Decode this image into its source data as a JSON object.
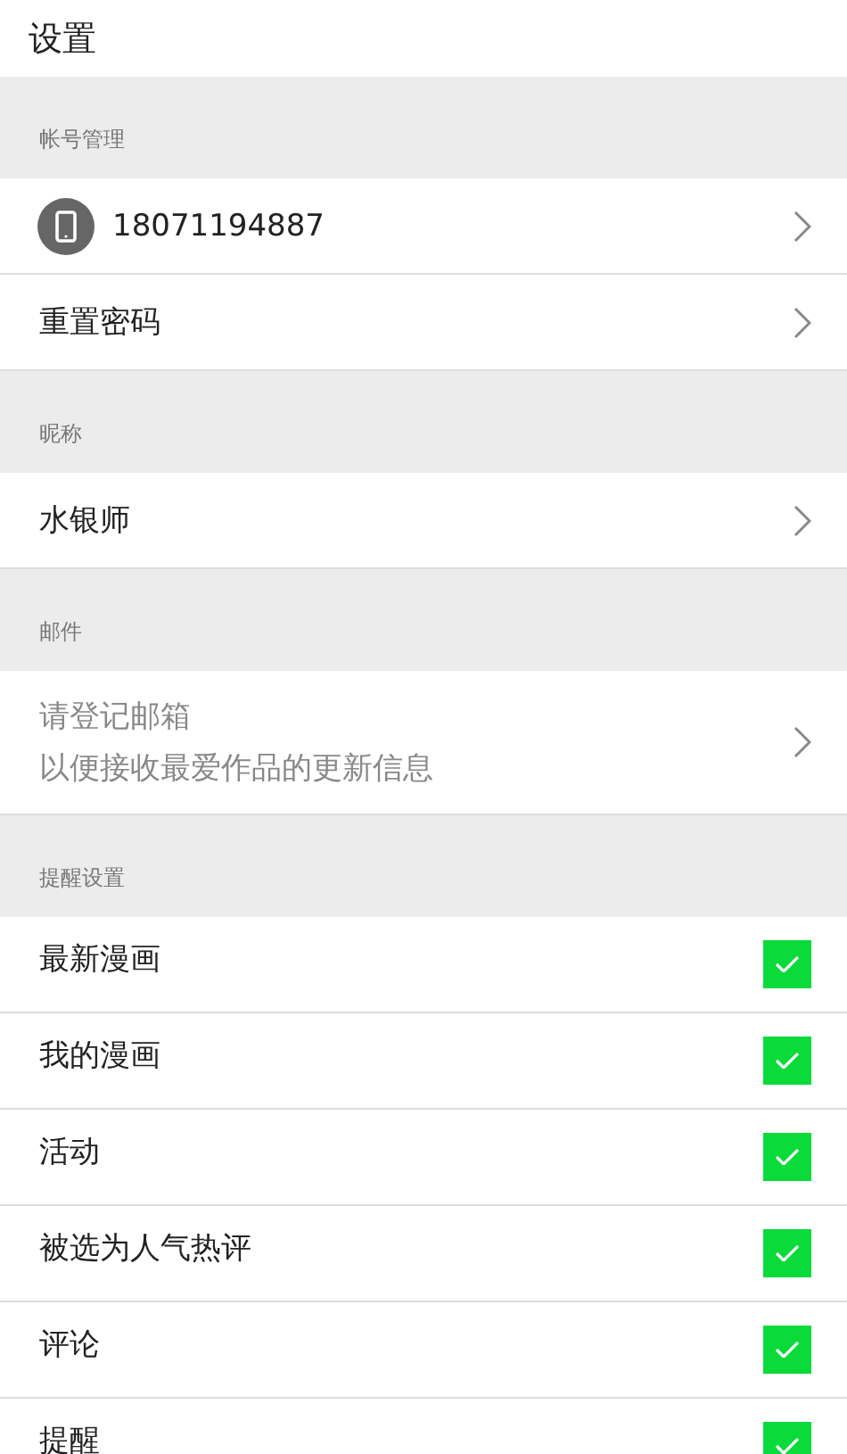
{
  "title": "设置",
  "sections": [
    {
      "header": "帐号管理",
      "rows": [
        {
          "kind": "phone",
          "label": "18071194887"
        },
        {
          "kind": "nav",
          "label": "重置密码"
        }
      ]
    },
    {
      "header": "昵称",
      "rows": [
        {
          "kind": "nav",
          "label": "水银师"
        }
      ]
    },
    {
      "header": "邮件",
      "rows": [
        {
          "kind": "hint",
          "lines": [
            "请登记邮箱",
            "以便接收最爱作品的更新信息"
          ]
        }
      ]
    },
    {
      "header": "提醒设置",
      "rows": [
        {
          "kind": "check",
          "label": "最新漫画",
          "checked": true
        },
        {
          "kind": "check",
          "label": "我的漫画",
          "checked": true
        },
        {
          "kind": "check",
          "label": "活动",
          "checked": true
        },
        {
          "kind": "check",
          "label": "被选为人气热评",
          "checked": true
        },
        {
          "kind": "check",
          "label": "评论",
          "checked": true
        },
        {
          "kind": "check",
          "label": "提醒",
          "checked": true
        }
      ]
    }
  ]
}
